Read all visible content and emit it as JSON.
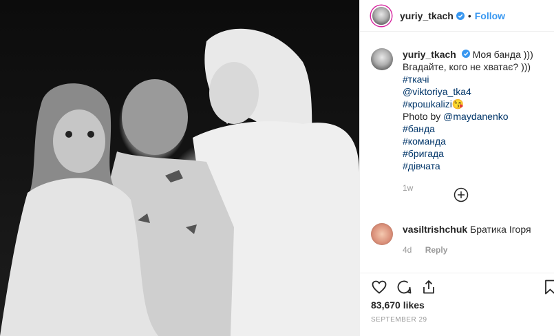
{
  "post": {
    "username": "yuriy_tkach",
    "follow_label": "Follow",
    "separator": "•",
    "caption": {
      "username": "yuriy_tkach",
      "line1": "Моя банда )))",
      "line2": "Вгадайте, кого не хватає? )))",
      "tags": [
        "#ткачі",
        "@viktoriya_tka4",
        "#крошkalizi😘"
      ],
      "photo_by_prefix": "Photo by ",
      "photo_by_user": "@maydanenko",
      "tags2": [
        "#банда",
        "#команда",
        "#бригада",
        "#дівчата"
      ],
      "age": "1w"
    },
    "comment": {
      "username": "vasiltrishchuk",
      "text": "Братика Ігоря",
      "age": "4d",
      "reply_label": "Reply"
    },
    "likes": "83,670 likes",
    "date": "SEPTEMBER 29"
  },
  "icons": [
    "verified-badge-icon",
    "plus-circle-icon",
    "heart-icon",
    "comment-icon",
    "share-icon",
    "bookmark-icon"
  ],
  "colors": {
    "link": "#003569",
    "follow": "#3897f0",
    "verified": "#3897f0",
    "muted": "#999999"
  }
}
